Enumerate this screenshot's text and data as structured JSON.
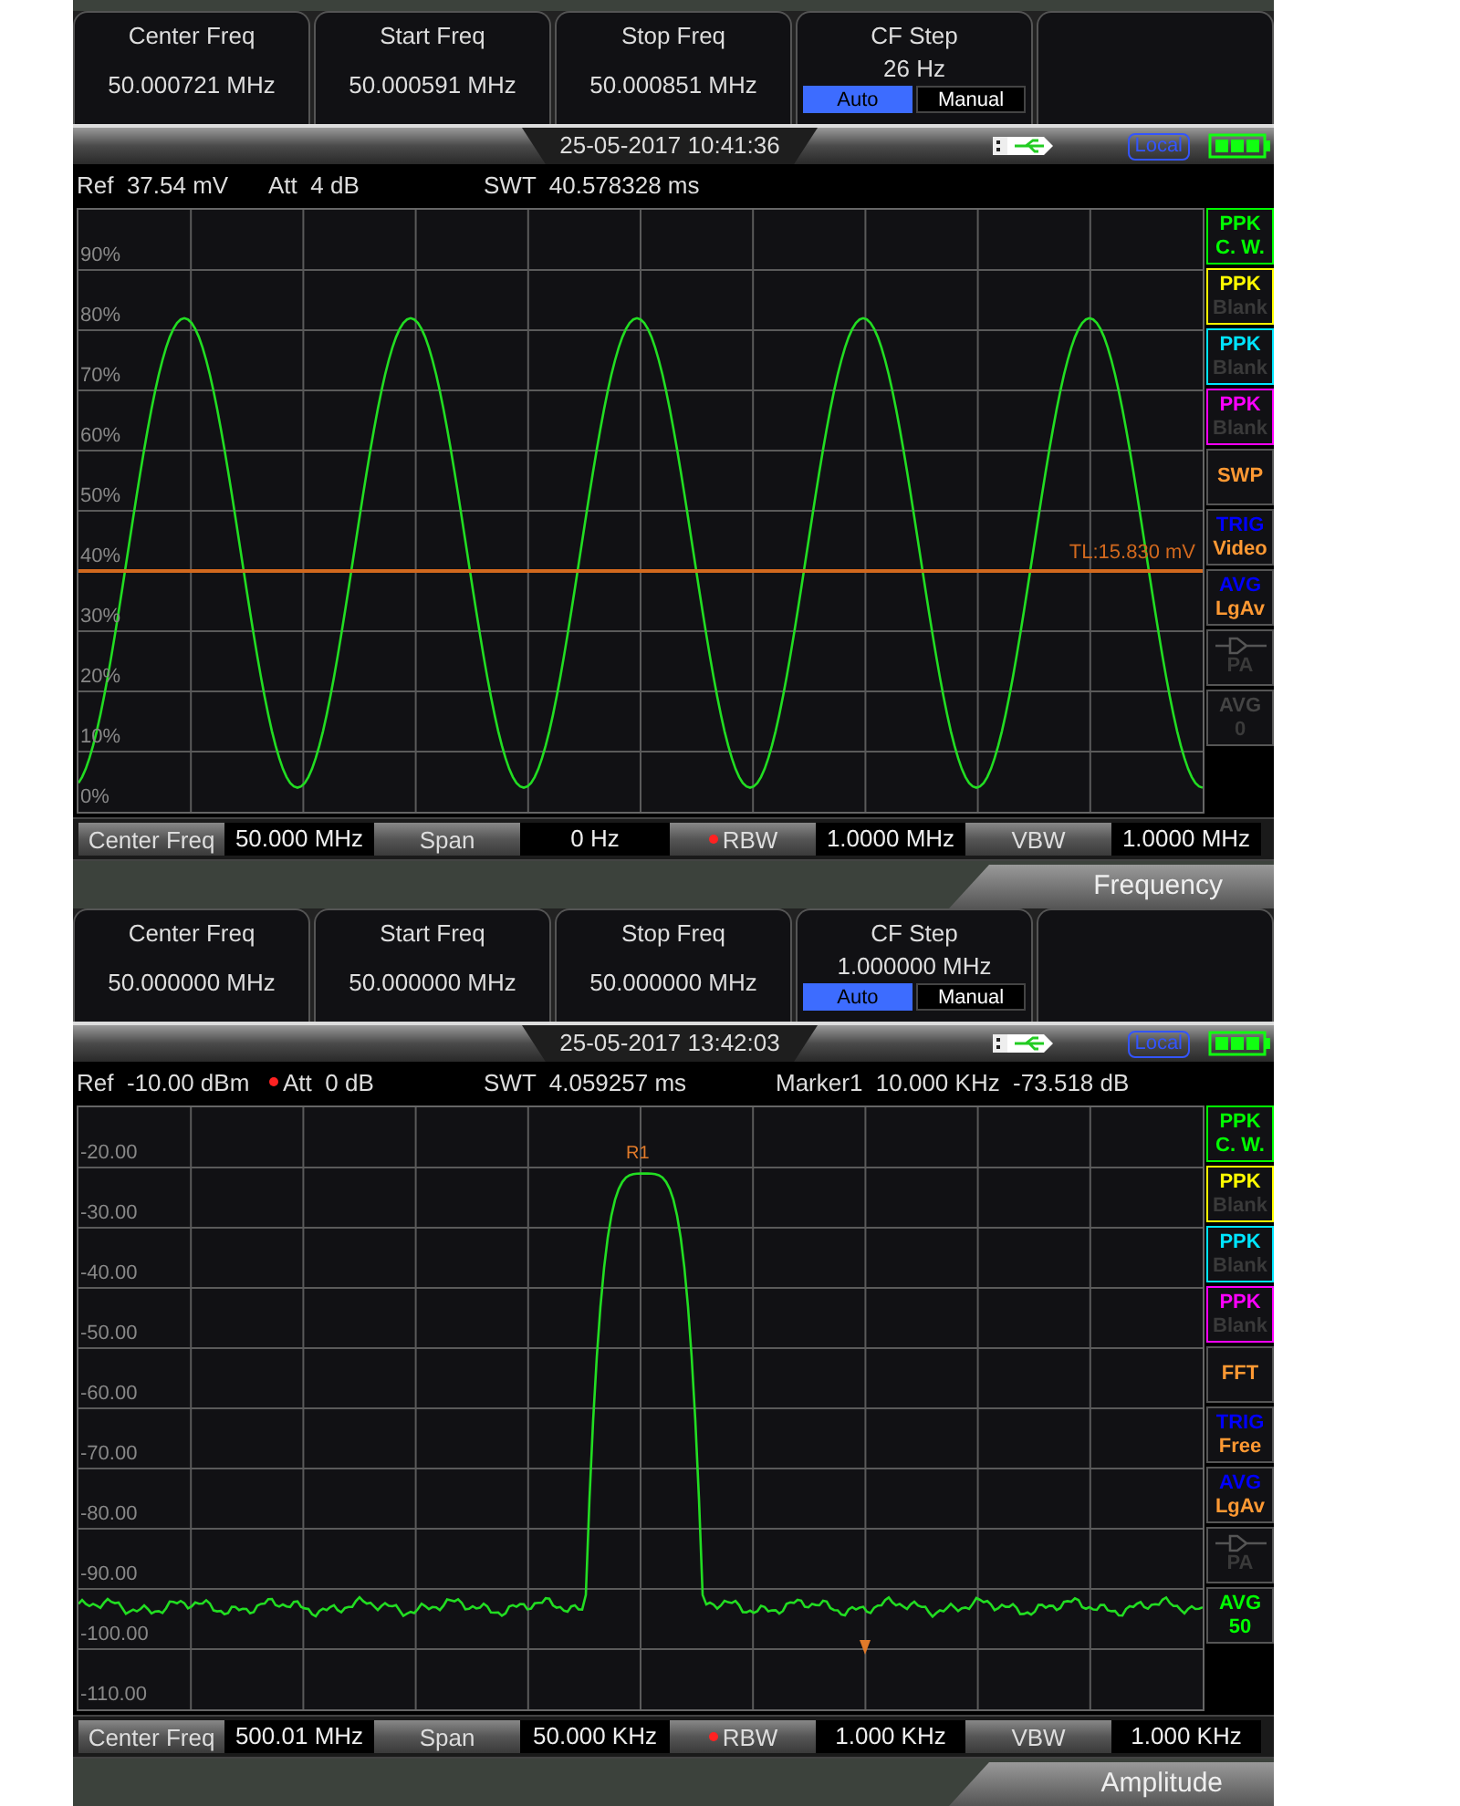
{
  "screens": [
    {
      "softkeys": [
        {
          "kind": "value",
          "label": "Center Freq",
          "value": "50.000721 MHz"
        },
        {
          "kind": "value",
          "label": "Start Freq",
          "value": "50.000591 MHz"
        },
        {
          "kind": "value",
          "label": "Stop Freq",
          "value": "50.000851 MHz"
        },
        {
          "kind": "toggle",
          "label": "CF Step",
          "value": "26 Hz",
          "options": [
            {
              "label": "Auto",
              "selected": true
            },
            {
              "label": "Manual",
              "selected": false
            }
          ]
        },
        {
          "kind": "empty"
        }
      ],
      "status": {
        "datetime": "25-05-2017 10:41:36",
        "remote": "Local"
      },
      "info": [
        {
          "label": "Ref",
          "value": "37.54 mV",
          "starred": false
        },
        {
          "label": "Att",
          "value": "4 dB",
          "starred": false
        },
        {
          "label": "SWT",
          "value": "40.578328 ms",
          "starred": false
        }
      ],
      "plot": {
        "kind": "sine",
        "y_labels": [
          "90%",
          "80%",
          "70%",
          "60%",
          "50%",
          "40%",
          "30%",
          "20%",
          "10%",
          "0%"
        ],
        "threshold": {
          "label": "TL:15.830 mV"
        }
      },
      "side_panel": [
        {
          "kind": "trace",
          "title": "PPK",
          "value": "C. W.",
          "color": "#00ff00",
          "enabled": true
        },
        {
          "kind": "trace",
          "title": "PPK",
          "value": "Blank",
          "color": "#ffff00",
          "enabled": false
        },
        {
          "kind": "trace",
          "title": "PPK",
          "value": "Blank",
          "color": "#00e5ff",
          "enabled": false
        },
        {
          "kind": "trace",
          "title": "PPK",
          "value": "Blank",
          "color": "#ff00ff",
          "enabled": false
        },
        {
          "kind": "mode",
          "title": "SWP",
          "enabled": true
        },
        {
          "kind": "status",
          "title": "TRIG",
          "value": "Video",
          "color": "#0000ff",
          "enabled": true
        },
        {
          "kind": "status",
          "title": "AVG",
          "value": "LgAv",
          "color": "#0000ff",
          "enabled": true
        },
        {
          "kind": "amp",
          "value": "PA",
          "enabled": false
        },
        {
          "kind": "counter",
          "title": "AVG",
          "value": "0",
          "enabled": false
        }
      ],
      "params": [
        {
          "label": "Center Freq",
          "value": "50.000 MHz",
          "starred": false
        },
        {
          "label": "Span",
          "value": "0 Hz",
          "starred": false
        },
        {
          "label": "RBW",
          "value": "1.0000 MHz",
          "starred": true
        },
        {
          "label": "VBW",
          "value": "1.0000 MHz",
          "starred": false
        }
      ],
      "menu_title": "Frequency"
    },
    {
      "softkeys": [
        {
          "kind": "value",
          "label": "Center Freq",
          "value": "50.000000 MHz"
        },
        {
          "kind": "value",
          "label": "Start Freq",
          "value": "50.000000 MHz"
        },
        {
          "kind": "value",
          "label": "Stop Freq",
          "value": "50.000000 MHz"
        },
        {
          "kind": "toggle",
          "label": "CF Step",
          "value": "1.000000 MHz",
          "options": [
            {
              "label": "Auto",
              "selected": true
            },
            {
              "label": "Manual",
              "selected": false
            }
          ]
        },
        {
          "kind": "empty"
        }
      ],
      "status": {
        "datetime": "25-05-2017 13:42:03",
        "remote": "Local"
      },
      "info": [
        {
          "label": "Ref",
          "value": "-10.00 dBm",
          "starred": false
        },
        {
          "label": "Att",
          "value": "0 dB",
          "starred": true
        },
        {
          "label": "SWT",
          "value": "4.059257 ms",
          "starred": false
        },
        {
          "label": "Marker1",
          "value": "10.000 KHz  -73.518 dB",
          "starred": false
        }
      ],
      "plot": {
        "kind": "peak",
        "y_labels": [
          "-20.00",
          "-30.00",
          "-40.00",
          "-50.00",
          "-60.00",
          "-70.00",
          "-80.00",
          "-90.00",
          "-100.00",
          "-110.00"
        ],
        "marker_label": "R1"
      },
      "side_panel": [
        {
          "kind": "trace",
          "title": "PPK",
          "value": "C. W.",
          "color": "#00ff00",
          "enabled": true
        },
        {
          "kind": "trace",
          "title": "PPK",
          "value": "Blank",
          "color": "#ffff00",
          "enabled": false
        },
        {
          "kind": "trace",
          "title": "PPK",
          "value": "Blank",
          "color": "#00e5ff",
          "enabled": false
        },
        {
          "kind": "trace",
          "title": "PPK",
          "value": "Blank",
          "color": "#ff00ff",
          "enabled": false
        },
        {
          "kind": "mode",
          "title": "FFT",
          "enabled": true
        },
        {
          "kind": "status",
          "title": "TRIG",
          "value": "Free",
          "color": "#0000ff",
          "enabled": true
        },
        {
          "kind": "status",
          "title": "AVG",
          "value": "LgAv",
          "color": "#0000ff",
          "enabled": true
        },
        {
          "kind": "amp",
          "value": "PA",
          "enabled": false
        },
        {
          "kind": "counter",
          "title": "AVG",
          "value": "50",
          "color": "#00ff00",
          "enabled": true
        }
      ],
      "params": [
        {
          "label": "Center Freq",
          "value": "500.01 MHz",
          "starred": false
        },
        {
          "label": "Span",
          "value": "50.000 KHz",
          "starred": false
        },
        {
          "label": "RBW",
          "value": "1.000 KHz",
          "starred": true
        },
        {
          "label": "VBW",
          "value": "1.000 KHz",
          "starred": false
        }
      ],
      "menu_title": "Amplitude"
    }
  ]
}
